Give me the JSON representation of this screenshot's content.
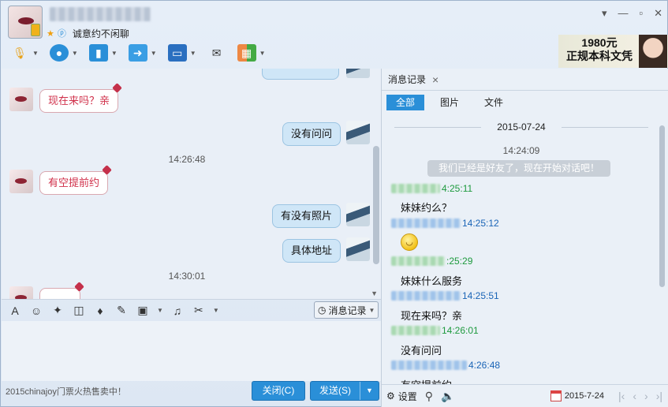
{
  "header": {
    "signature": "诚意约不闲聊",
    "controls": [
      "▾",
      "▫",
      "✕"
    ]
  },
  "ad": {
    "line1": "1980元",
    "line2": "正规本科文凭"
  },
  "chat": {
    "messages": [
      {
        "text": "现在来吗？亲"
      },
      {
        "text": "没有问问"
      },
      {
        "text": "14:26:48"
      },
      {
        "text": "有空提前约"
      },
      {
        "text": "有没有照片"
      },
      {
        "text": "具体地址"
      },
      {
        "text": "14:30:01"
      }
    ]
  },
  "input": {
    "history_label": "消息记录",
    "promo": "2015chinajoy门票火热售卖中！",
    "close_label": "关闭(C)",
    "send_label": "发送(S)"
  },
  "history": {
    "tab": "消息记录",
    "filters": [
      "全部",
      "图片",
      "文件"
    ],
    "date": "2015-07-24",
    "time": "14:24:09",
    "notice": "我们已经是好友了，现在开始对话吧！",
    "entries": [
      {
        "time": "4:25:11",
        "text": "妹妹约么？"
      },
      {
        "time": "14:25:12",
        "text": ""
      },
      {
        "time": ":25:29",
        "text": "妹妹什么服务"
      },
      {
        "time": "14:25:51",
        "text": "现在来吗？亲"
      },
      {
        "time": "14:26:01",
        "text": "没有问问"
      },
      {
        "time": "4:26:48",
        "text": "有空提前约"
      }
    ],
    "settings_label": "设置",
    "bottom_date": "2015-7-24"
  }
}
